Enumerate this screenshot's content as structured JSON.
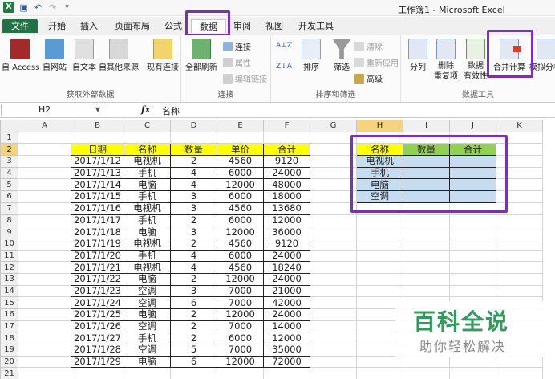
{
  "window": {
    "title": "工作簿1 - Microsoft Excel",
    "app_icon_label": "X"
  },
  "tabs": [
    "文件",
    "开始",
    "插入",
    "页面布局",
    "公式",
    "数据",
    "审阅",
    "视图",
    "开发工具"
  ],
  "active_tab": "数据",
  "ribbon": {
    "get_external": {
      "label": "获取外部数据",
      "buttons": [
        "自 Access",
        "自网站",
        "自文本",
        "自其他来源",
        "现有连接"
      ]
    },
    "connections": {
      "label": "连接",
      "refresh_all": "全部刷新",
      "connections": "连接",
      "properties": "属性",
      "edit_links": "编辑链接"
    },
    "sort_filter": {
      "label": "排序和筛选",
      "sort": "排序",
      "filter": "筛选",
      "clear": "清除",
      "reapply": "重新应用",
      "advanced": "高级"
    },
    "data_tools": {
      "label": "数据工具",
      "split": "分列",
      "remove_dup_1": "删除",
      "remove_dup_2": "重复项",
      "validation_1": "数据",
      "validation_2": "有效性",
      "consolidate": "合并计算",
      "whatif": "模拟分析"
    }
  },
  "formula_bar": {
    "name_box": "H2",
    "fx": "fx",
    "content": "名称"
  },
  "sheet": {
    "columns": [
      "A",
      "B",
      "C",
      "D",
      "E",
      "F",
      "G",
      "H",
      "I",
      "J",
      "K"
    ],
    "selected_column": "H",
    "selected_row": "2",
    "row_numbers": [
      "1",
      "2",
      "3",
      "4",
      "5",
      "6",
      "7",
      "8",
      "9",
      "10",
      "11",
      "12",
      "13",
      "14",
      "15",
      "16",
      "17",
      "18",
      "19",
      "20",
      "21"
    ],
    "headers": [
      "日期",
      "名称",
      "数量",
      "单价",
      "合计"
    ],
    "rows": [
      [
        "2017/1/12",
        "电视机",
        "2",
        "4560",
        "9120"
      ],
      [
        "2017/1/13",
        "手机",
        "4",
        "6000",
        "24000"
      ],
      [
        "2017/1/14",
        "电脑",
        "4",
        "12000",
        "48000"
      ],
      [
        "2017/1/15",
        "手机",
        "3",
        "6000",
        "18000"
      ],
      [
        "2017/1/16",
        "电视机",
        "3",
        "4560",
        "13680"
      ],
      [
        "2017/1/17",
        "手机",
        "2",
        "6000",
        "12000"
      ],
      [
        "2017/1/18",
        "电脑",
        "3",
        "12000",
        "36000"
      ],
      [
        "2017/1/19",
        "电视机",
        "2",
        "4560",
        "9120"
      ],
      [
        "2017/1/20",
        "手机",
        "4",
        "6000",
        "24000"
      ],
      [
        "2017/1/21",
        "电视机",
        "4",
        "4560",
        "18240"
      ],
      [
        "2017/1/22",
        "电脑",
        "2",
        "12000",
        "24000"
      ],
      [
        "2017/1/23",
        "空调",
        "3",
        "7000",
        "21000"
      ],
      [
        "2017/1/24",
        "空调",
        "6",
        "7000",
        "42000"
      ],
      [
        "2017/1/25",
        "电脑",
        "2",
        "12000",
        "24000"
      ],
      [
        "2017/1/26",
        "空调",
        "2",
        "7000",
        "14000"
      ],
      [
        "2017/1/27",
        "手机",
        "2",
        "6000",
        "12000"
      ],
      [
        "2017/1/28",
        "空调",
        "5",
        "7000",
        "35000"
      ],
      [
        "2017/1/29",
        "电脑",
        "6",
        "12000",
        "72000"
      ]
    ],
    "summary_headers": [
      "名称",
      "数量",
      "合计"
    ],
    "summary_items": [
      "电视机",
      "手机",
      "电脑",
      "空调"
    ]
  },
  "watermark": {
    "title": "百科全说",
    "subtitle": "助你轻松解决"
  },
  "colors": {
    "header_fill": "#ffff00",
    "summary_header_fill": "#92d050",
    "summary_body_fill": "#c5dcf1",
    "highlight_border": "#7b30b8",
    "file_tab": "#217346"
  }
}
